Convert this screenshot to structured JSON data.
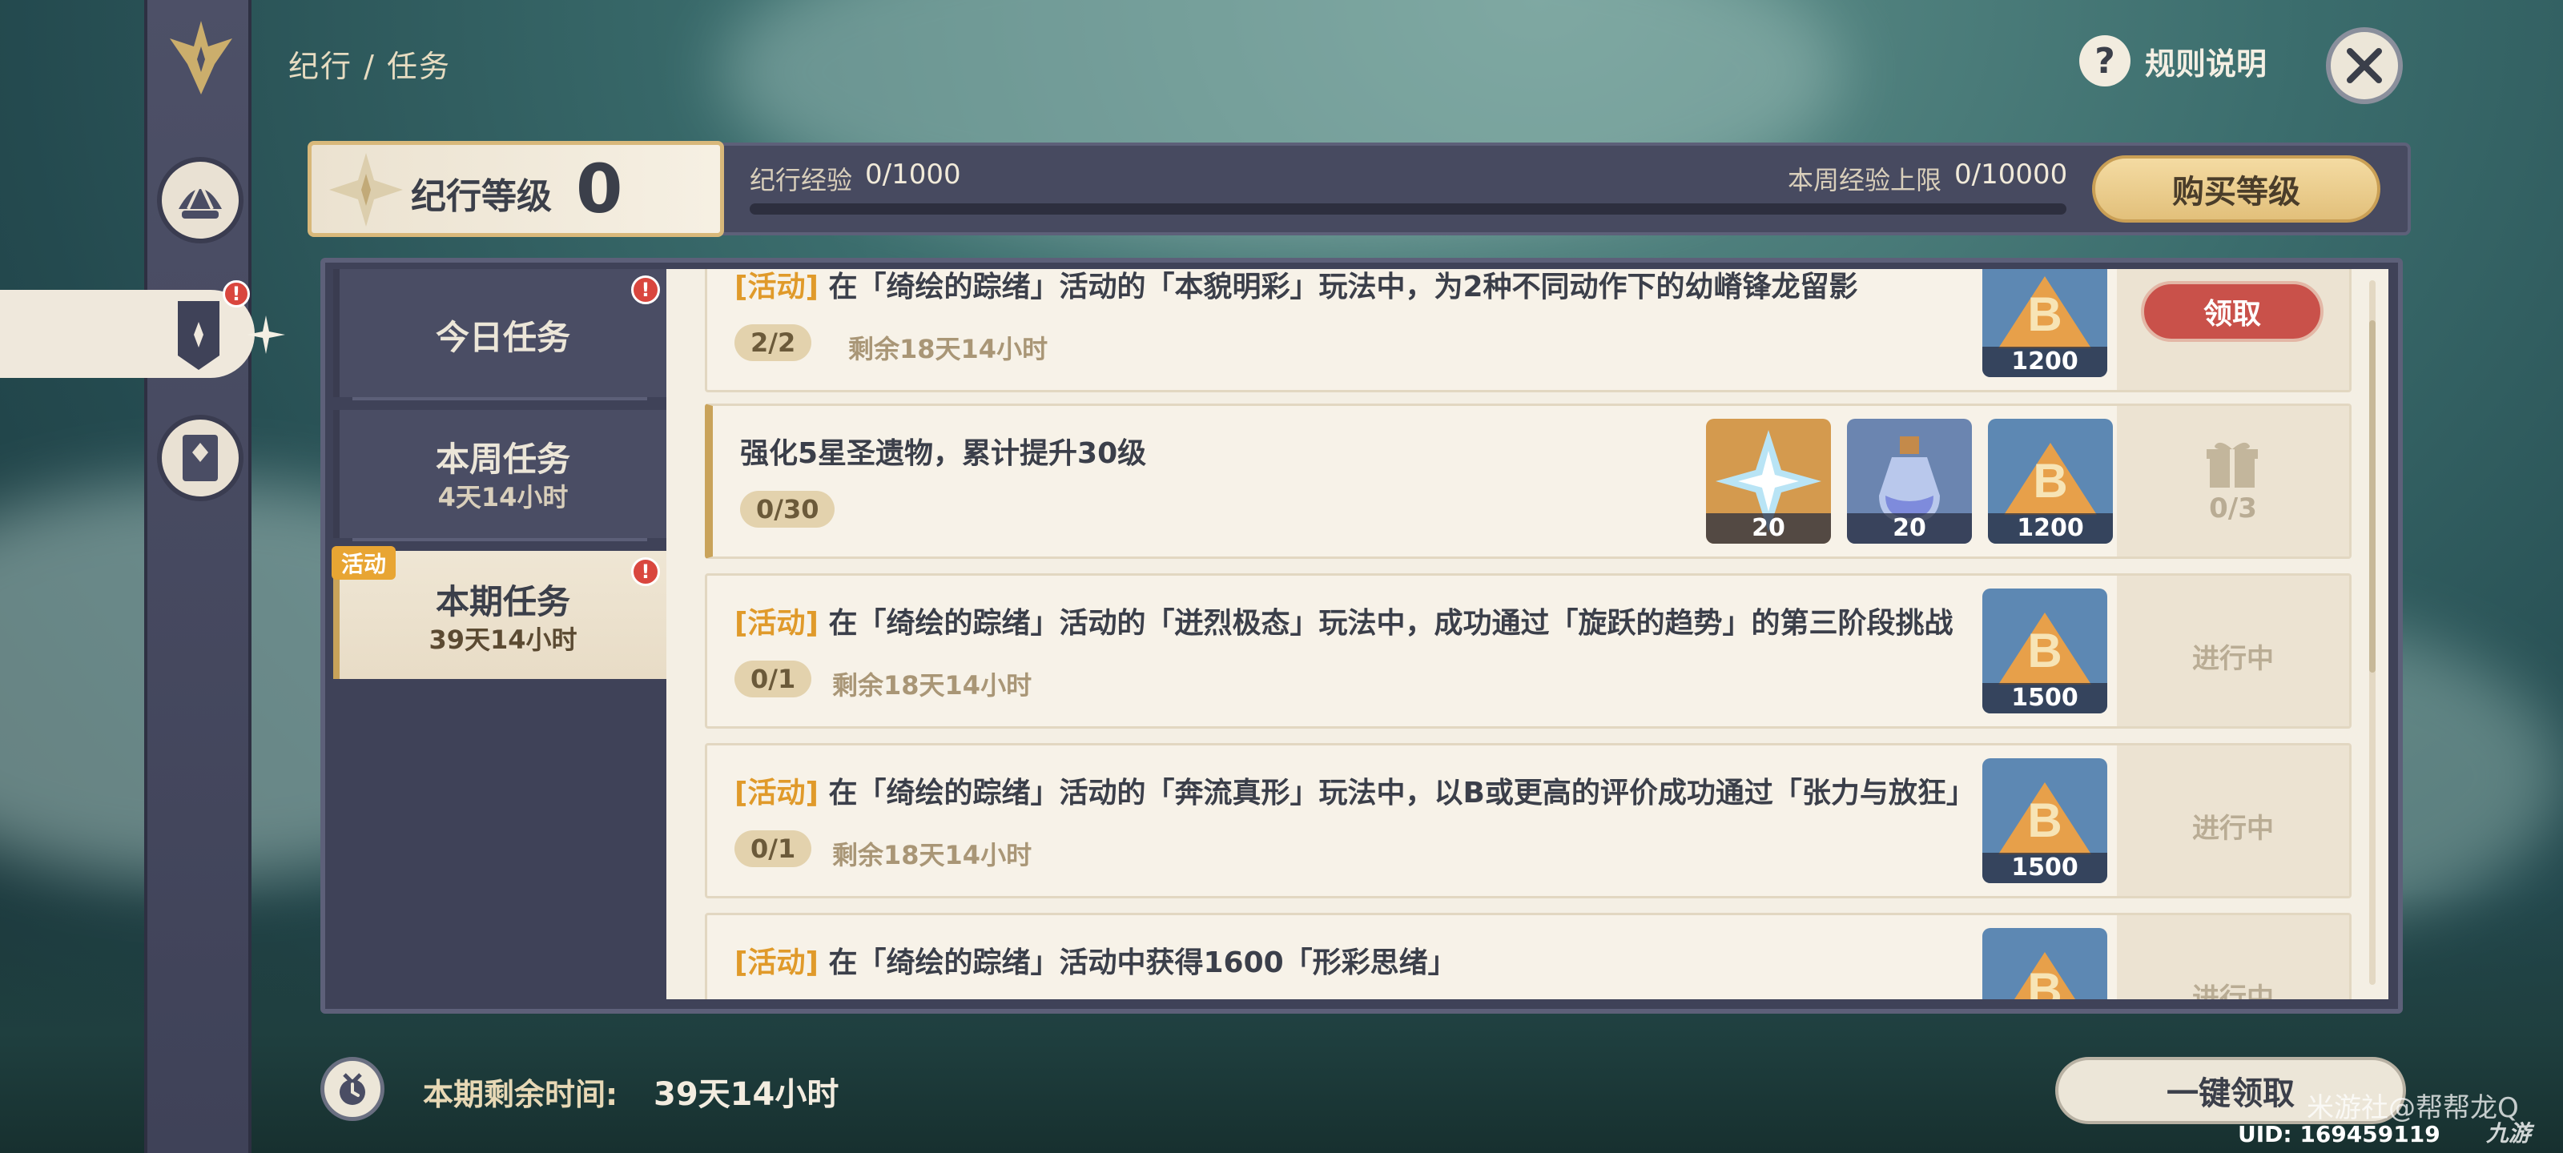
{
  "header": {
    "breadcrumb": "纪行 / 任务",
    "rules_label": "规则说明",
    "rules_icon": "question-icon",
    "close_icon": "close-icon"
  },
  "level_bar": {
    "level_label": "纪行等级",
    "level_value": "0",
    "exp_label": "纪行经验",
    "exp_value": "0/1000",
    "exp_progress": 0,
    "week_label": "本周经验上限",
    "week_value": "0/10000",
    "buy_label": "购买等级"
  },
  "tabs": [
    {
      "title": "今日任务",
      "subtitle": "",
      "alert": "!",
      "active": false
    },
    {
      "title": "本周任务",
      "subtitle": "4天14小时",
      "alert": "",
      "active": false
    },
    {
      "title": "本期任务",
      "subtitle": "39天14小时",
      "alert": "!",
      "badge": "活动",
      "active": true
    }
  ],
  "tasks": [
    {
      "tag": "[活动]",
      "title": "在「绮绘的踪绪」活动的「本貌明彩」玩法中，为2种不同动作下的幼嵴锋龙留影",
      "progress": "2/2",
      "remain": "剩余18天14小时",
      "rewards": [
        {
          "icon": "battlepass-exp-icon",
          "count": "1200"
        }
      ],
      "status": "领取",
      "claimable": true
    },
    {
      "tag": "",
      "title": "强化5星圣遗物，累计提升30级",
      "progress": "0/30",
      "remain": "",
      "rewards": [
        {
          "icon": "primogem-icon",
          "count": "20"
        },
        {
          "icon": "fragile-resin-icon",
          "count": "20"
        },
        {
          "icon": "battlepass-exp-icon",
          "count": "1200"
        }
      ],
      "status": "0/3",
      "claimable": false
    },
    {
      "tag": "[活动]",
      "title": "在「绮绘的踪绪」活动的「迸烈极态」玩法中，成功通过「旋跃的趋势」的第三阶段挑战",
      "progress": "0/1",
      "remain": "剩余18天14小时",
      "rewards": [
        {
          "icon": "battlepass-exp-icon",
          "count": "1500"
        }
      ],
      "status": "进行中",
      "claimable": false
    },
    {
      "tag": "[活动]",
      "title": "在「绮绘的踪绪」活动的「奔流真形」玩法中，以B或更高的评价成功通过「张力与放狂」",
      "progress": "0/1",
      "remain": "剩余18天14小时",
      "rewards": [
        {
          "icon": "battlepass-exp-icon",
          "count": "1500"
        }
      ],
      "status": "进行中",
      "claimable": false
    },
    {
      "tag": "[活动]",
      "title": "在「绮绘的踪绪」活动中获得1600「形彩思绪」",
      "progress": "",
      "remain": "",
      "rewards": [
        {
          "icon": "battlepass-exp-icon",
          "count": ""
        }
      ],
      "status": "进行中",
      "claimable": false
    }
  ],
  "footer": {
    "remaining_label": "本期剩余时间:",
    "remaining_value": "39天14小时",
    "claim_all_label": "一键领取",
    "uid": "UID: 169459119",
    "watermark": "米游社@帮帮龙Q",
    "watermark_logo": "九游"
  },
  "colors": {
    "accent_gold": "#d9b86d",
    "claim_red": "#c9514a",
    "tag_orange": "#e09a2a",
    "panel_dark": "#3f4258",
    "card_cream": "#f7f2e8"
  }
}
